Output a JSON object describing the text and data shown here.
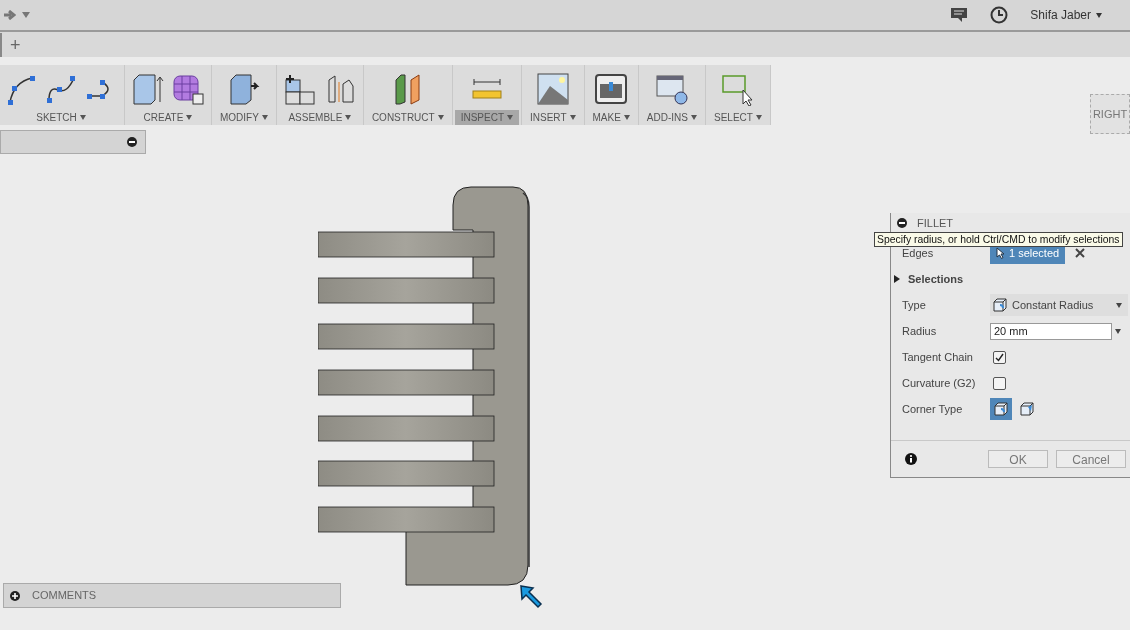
{
  "top_bar": {
    "user": "Shifa Jaber"
  },
  "tab_bar": {
    "new_tab": "+"
  },
  "toolbar": [
    {
      "label": "SKETCH",
      "selected": false,
      "icons": [
        {
          "kind": "arc"
        },
        {
          "kind": "spline"
        },
        {
          "kind": "line-arc"
        }
      ]
    },
    {
      "label": "CREATE",
      "selected": false,
      "icons": [
        {
          "kind": "box-extrude"
        },
        {
          "kind": "form"
        }
      ]
    },
    {
      "label": "MODIFY",
      "selected": false,
      "icons": [
        {
          "kind": "press-pull"
        }
      ]
    },
    {
      "label": "ASSEMBLE",
      "selected": false,
      "icons": [
        {
          "kind": "new-component"
        },
        {
          "kind": "joint"
        }
      ]
    },
    {
      "label": "CONSTRUCT",
      "selected": false,
      "icons": [
        {
          "kind": "plane"
        }
      ]
    },
    {
      "label": "INSPECT",
      "selected": true,
      "icons": [
        {
          "kind": "ruler"
        }
      ]
    },
    {
      "label": "INSERT",
      "selected": false,
      "icons": [
        {
          "kind": "image"
        }
      ]
    },
    {
      "label": "MAKE",
      "selected": false,
      "icons": [
        {
          "kind": "printer"
        }
      ]
    },
    {
      "label": "ADD-INS",
      "selected": false,
      "icons": [
        {
          "kind": "script"
        }
      ]
    },
    {
      "label": "SELECT",
      "selected": false,
      "icons": [
        {
          "kind": "select-box"
        }
      ]
    }
  ],
  "view_cube": {
    "face": "RIGHT"
  },
  "fillet": {
    "title": "FILLET",
    "tooltip": "Specify radius, or hold Ctrl/CMD to modify selections",
    "edges": {
      "label": "Edges",
      "value": "1 selected"
    },
    "selections": {
      "label": "Selections",
      "expanded": false
    },
    "type": {
      "label": "Type",
      "value": "Constant Radius"
    },
    "radius": {
      "label": "Radius",
      "value": "20 mm"
    },
    "tangent_chain": {
      "label": "Tangent Chain",
      "checked": true
    },
    "curvature": {
      "label": "Curvature (G2)",
      "checked": false
    },
    "corner_type": {
      "label": "Corner Type",
      "options": [
        {
          "kind": "rolling",
          "selected": true
        },
        {
          "kind": "setback",
          "selected": false
        }
      ]
    },
    "buttons": [
      "OK",
      "Cancel"
    ]
  },
  "comments": {
    "label": "COMMENTS"
  }
}
